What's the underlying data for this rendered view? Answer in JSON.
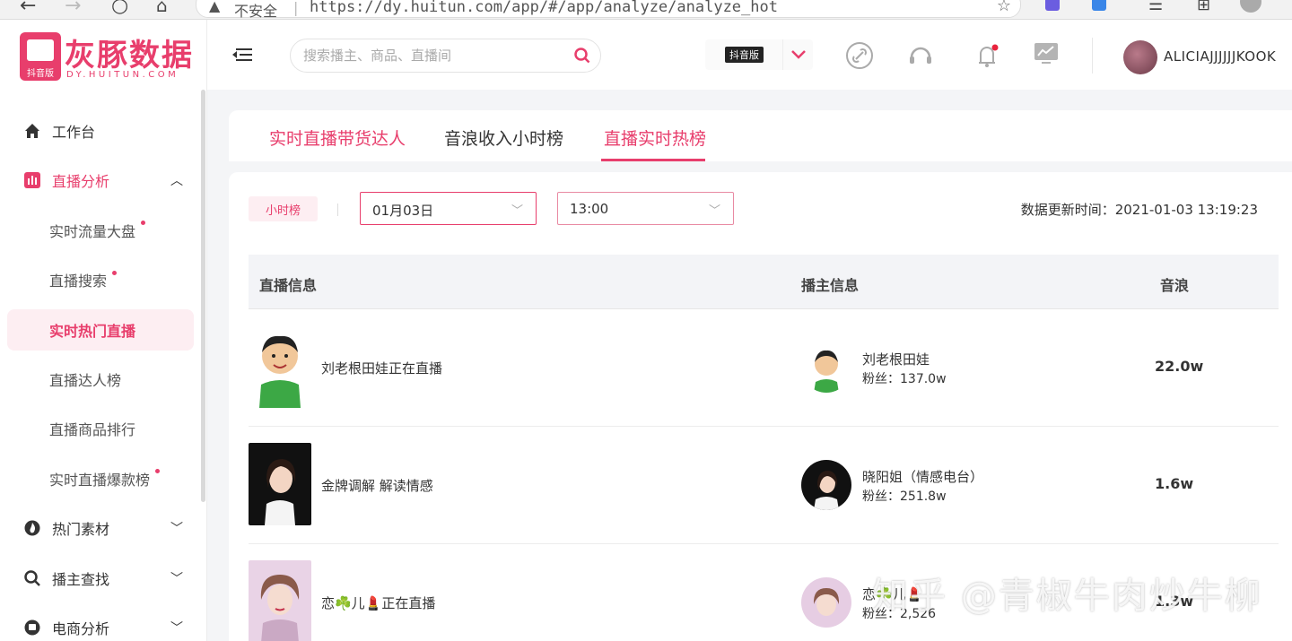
{
  "browser": {
    "insecure_label": "不安全",
    "url": "https://dy.huitun.com/app/#/app/analyze/analyze_hot"
  },
  "logo": {
    "title": "灰豚数据",
    "badge": "抖音版",
    "domain": "DY.HUITUN.COM"
  },
  "sidebar": {
    "items": [
      {
        "label": "工作台",
        "icon": "home-icon"
      },
      {
        "label": "直播分析",
        "icon": "bar-chart-icon"
      },
      {
        "label": "实时流量大盘"
      },
      {
        "label": "直播搜索"
      },
      {
        "label": "实时热门直播"
      },
      {
        "label": "直播达人榜"
      },
      {
        "label": "直播商品排行"
      },
      {
        "label": "实时直播爆款榜"
      },
      {
        "label": "热门素材",
        "icon": "fire-icon"
      },
      {
        "label": "播主查找",
        "icon": "search-icon"
      },
      {
        "label": "电商分析",
        "icon": "shop-icon"
      }
    ]
  },
  "header": {
    "search_placeholder": "搜索播主、商品、直播间",
    "platform_tag": "抖音版",
    "username": "ALICIAJJJJJJKOOK"
  },
  "tabs": [
    {
      "label": "实时直播带货达人"
    },
    {
      "label": "音浪收入小时榜"
    },
    {
      "label": "直播实时热榜"
    }
  ],
  "filters": {
    "period_tag": "小时榜",
    "date": "01月03日",
    "hour": "13:00",
    "update_time": "数据更新时间：2021-01-03 13:19:23"
  },
  "table": {
    "headers": [
      "直播信息",
      "播主信息",
      "音浪"
    ],
    "rows": [
      {
        "title": "刘老根田娃正在直播",
        "anchor": "刘老根田娃",
        "fans": "粉丝：137.0w",
        "wave": "22.0w"
      },
      {
        "title": "金牌调解 解读情感",
        "anchor": "晓阳姐（情感电台）",
        "fans": "粉丝：251.8w",
        "wave": "1.6w"
      },
      {
        "title": "恋☘️儿💄正在直播",
        "anchor": "恋☘️儿💄",
        "fans": "粉丝：2,526",
        "wave": "1.3w"
      }
    ]
  },
  "watermark": "知乎 @青椒牛肉炒牛柳",
  "colors": {
    "accent": "#e83e6c"
  }
}
